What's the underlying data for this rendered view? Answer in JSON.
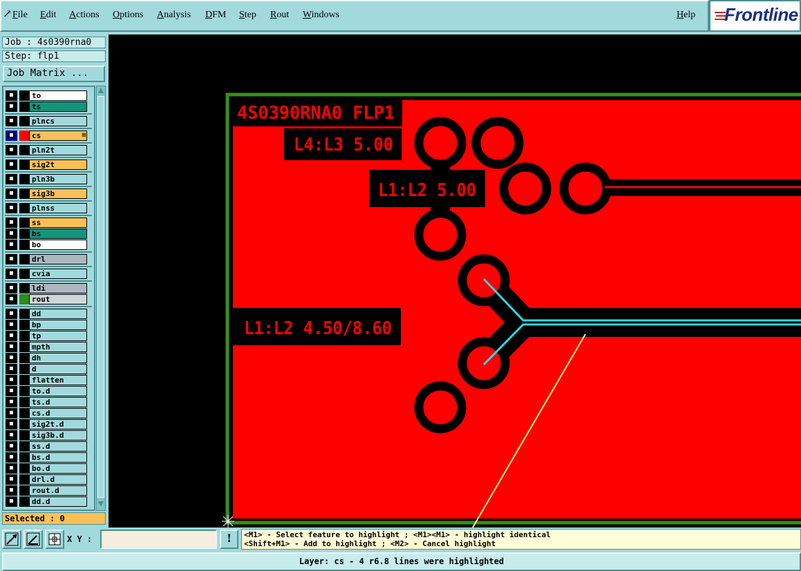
{
  "menubar": {
    "items": [
      {
        "label": "File",
        "icon": "pointer-arrow-icon"
      },
      {
        "label": "Edit"
      },
      {
        "label": "Actions"
      },
      {
        "label": "Options"
      },
      {
        "label": "Analysis"
      },
      {
        "label": "DFM"
      },
      {
        "label": "Step"
      },
      {
        "label": "Rout"
      },
      {
        "label": "Windows"
      }
    ],
    "help": "Help",
    "logo_text": "Frontline"
  },
  "panel": {
    "job": "Job : 4s0390rna0",
    "step": "Step: flp1",
    "job_matrix": "Job Matrix ...",
    "selected": "Selected : 0"
  },
  "layers": [
    {
      "name": "to",
      "color": "#ffffff",
      "swatch": "#000000"
    },
    {
      "name": "ts",
      "color": "#12957a",
      "swatch": "#000000"
    },
    {
      "name": "plncs",
      "color": "#a2d9dc",
      "swatch": "#000000"
    },
    {
      "name": "cs",
      "color": "#f8c058",
      "swatch": "#ff0000",
      "active": true
    },
    {
      "name": "pln2t",
      "color": "#a2d9dc",
      "swatch": "#000000"
    },
    {
      "name": "sig2t",
      "color": "#f8c058",
      "swatch": "#000000"
    },
    {
      "name": "pln3b",
      "color": "#a2d9dc",
      "swatch": "#000000"
    },
    {
      "name": "sig3b",
      "color": "#f8c058",
      "swatch": "#000000"
    },
    {
      "name": "plnss",
      "color": "#a2d9dc",
      "swatch": "#000000"
    },
    {
      "name": "ss",
      "color": "#f8c058",
      "swatch": "#000000"
    },
    {
      "name": "bs",
      "color": "#12957a",
      "swatch": "#000000"
    },
    {
      "name": "bo",
      "color": "#ffffff",
      "swatch": "#000000"
    },
    {
      "name": "drl",
      "color": "#a9b8be",
      "swatch": "#000000"
    },
    {
      "name": "cvia",
      "color": "#a2d9dc",
      "swatch": "#000000"
    },
    {
      "name": "ldi",
      "color": "#a9b8be",
      "swatch": "#000000"
    },
    {
      "name": "rout",
      "color": "#cfd6d8",
      "swatch": "#2e8b1e"
    },
    {
      "name": "dd",
      "color": "#a2d9dc",
      "swatch": "#000000"
    },
    {
      "name": "bp",
      "color": "#a2d9dc",
      "swatch": "#000000"
    },
    {
      "name": "tp",
      "color": "#a2d9dc",
      "swatch": "#000000"
    },
    {
      "name": "mpth",
      "color": "#a2d9dc",
      "swatch": "#000000"
    },
    {
      "name": "dh",
      "color": "#a2d9dc",
      "swatch": "#000000"
    },
    {
      "name": "d",
      "color": "#a2d9dc",
      "swatch": "#000000"
    },
    {
      "name": "flatten",
      "color": "#a2d9dc",
      "swatch": "#000000"
    },
    {
      "name": "to.d",
      "color": "#a2d9dc",
      "swatch": "#000000"
    },
    {
      "name": "ts.d",
      "color": "#a2d9dc",
      "swatch": "#000000"
    },
    {
      "name": "cs.d",
      "color": "#a2d9dc",
      "swatch": "#000000"
    },
    {
      "name": "sig2t.d",
      "color": "#a2d9dc",
      "swatch": "#000000"
    },
    {
      "name": "sig3b.d",
      "color": "#a2d9dc",
      "swatch": "#000000"
    },
    {
      "name": "ss.d",
      "color": "#a2d9dc",
      "swatch": "#000000"
    },
    {
      "name": "bs.d",
      "color": "#a2d9dc",
      "swatch": "#000000"
    },
    {
      "name": "bo.d",
      "color": "#a2d9dc",
      "swatch": "#000000"
    },
    {
      "name": "drl.d",
      "color": "#a2d9dc",
      "swatch": "#000000"
    },
    {
      "name": "rout.d",
      "color": "#a2d9dc",
      "swatch": "#000000"
    },
    {
      "name": "dd.d",
      "color": "#a2d9dc",
      "swatch": "#000000"
    }
  ],
  "canvas": {
    "board_labels": [
      "4S0390RNA0 FLP1",
      "L4:L3 5.00",
      "L1:L2 5.00",
      "L1:L2 4.50/8.60"
    ],
    "colors": {
      "copper": "#ff0000",
      "outline": "#3c8d1e",
      "highlight": "#33d6e6",
      "measure": "#ffff88",
      "background": "#000000"
    }
  },
  "toolbar": {
    "xy_label": "X Y :",
    "xy_value": "",
    "info_button": "!"
  },
  "messages": {
    "line1": "<M1> - Select feature to highlight ; <M1><M1> - highlight identical",
    "line2": "<Shift+M1> - Add to highlight ; <M2> - Cancel highlight"
  },
  "status": "Layer: cs - 4 r6.8 lines were highlighted"
}
